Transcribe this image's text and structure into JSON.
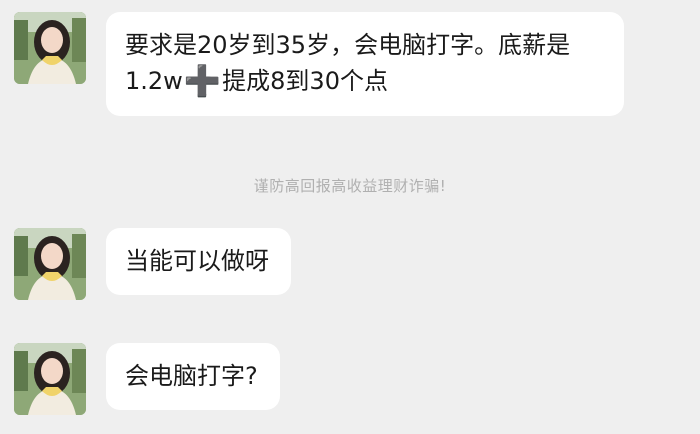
{
  "messages": [
    {
      "line1": "要求是20岁到35岁，会电脑打字。底薪是",
      "line2_before": "1.2w",
      "line2_icon": "➕",
      "line2_after": "提成8到30个点"
    },
    {
      "text": "当能可以做呀"
    },
    {
      "text": "会电脑打字?"
    }
  ],
  "system_notice": "谨防高回报高收益理财诈骗!",
  "colors": {
    "background": "#efefef",
    "bubble": "#ffffff",
    "text": "#1a1a1a",
    "notice": "#b0b0b0"
  }
}
